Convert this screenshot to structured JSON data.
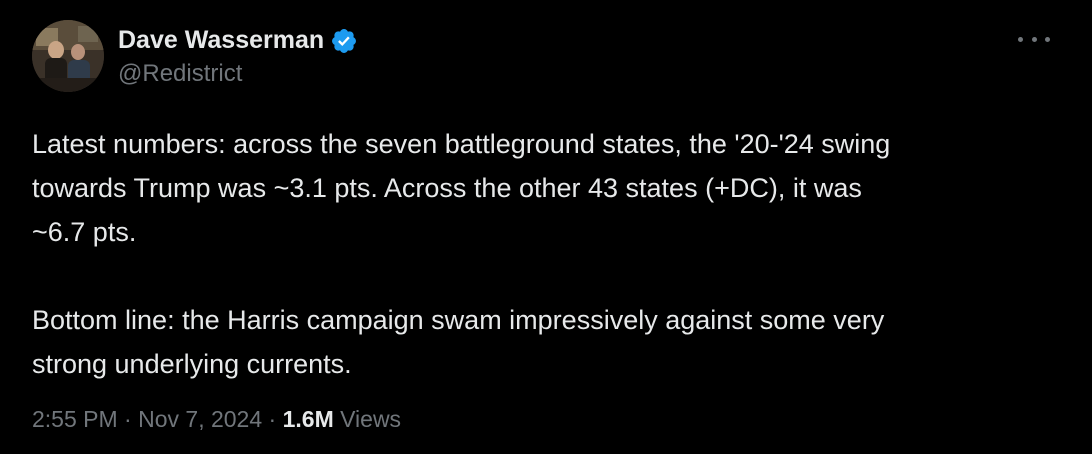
{
  "tweet": {
    "author": {
      "display_name": "Dave Wasserman",
      "handle": "@Redistrict",
      "verified": true,
      "verified_color": "#1d9bf0"
    },
    "more_icon": "more-horizontal-icon",
    "text": "Latest numbers: across the seven battleground states, the '20-'24 swing\ntowards Trump was ~3.1 pts. Across the other 43 states (+DC), it was\n~6.7 pts.\n\nBottom line: the Harris campaign swam impressively against some very\nstrong underlying currents.",
    "time": "2:55 PM",
    "separator": "·",
    "date": "Nov 7, 2024",
    "views_count": "1.6M",
    "views_label": "Views"
  },
  "theme": {
    "background": "#000000",
    "text_primary": "#e7e9ea",
    "text_secondary": "#71767b"
  }
}
